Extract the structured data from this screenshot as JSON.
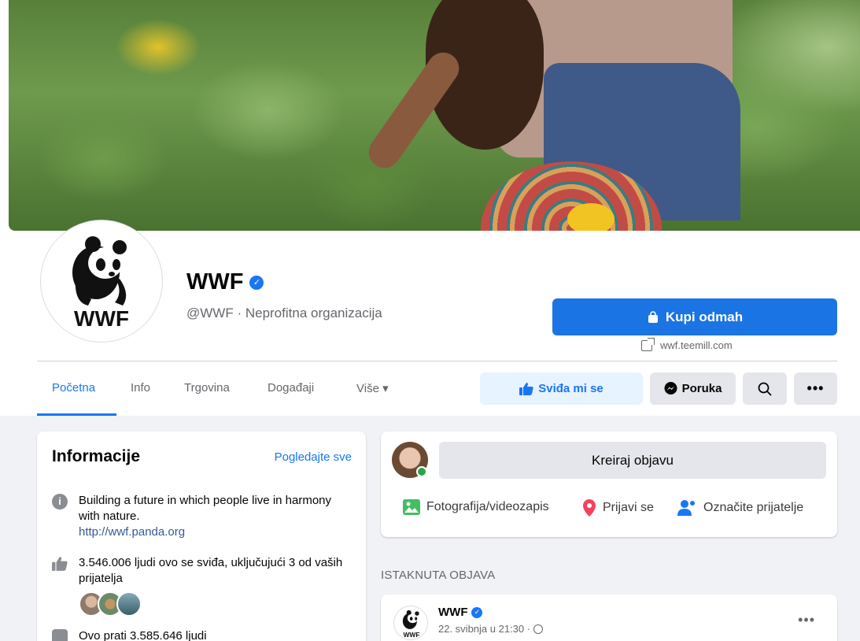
{
  "page": {
    "name": "WWF",
    "handle": "@WWF · Neprofitna organizacija",
    "logo_text": "WWF"
  },
  "shop": {
    "button_label": "Kupi odmah",
    "link_text": "wwf.teemill.com"
  },
  "tabs": [
    {
      "label": "Početna",
      "active": true
    },
    {
      "label": "Info"
    },
    {
      "label": "Trgovina"
    },
    {
      "label": "Događaji"
    },
    {
      "label": "Više ▾"
    }
  ],
  "actions": {
    "like_label": "Sviđa mi se",
    "message_label": "Poruka",
    "more_label": "•••"
  },
  "info": {
    "title": "Informacije",
    "see_all": "Pogledajte sve",
    "description": "Building a future in which people live in harmony with nature.",
    "website": "http://wwf.panda.org",
    "likes_text": "3.546.006 ljudi ovo se sviđa, uključujući 3 od vaših prijatelja",
    "followers_text": "Ovo prati 3.585.646 ljudi"
  },
  "composer": {
    "create_label": "Kreiraj objavu",
    "photo_label": "Fotografija/videozapis",
    "checkin_label": "Prijavi se",
    "tag_label": "Označite prijatelje"
  },
  "featured": {
    "label": "ISTAKNUTA OBJAVA",
    "author": "WWF",
    "time": "22. svibnja u 21:30 ·",
    "more": "•••"
  },
  "colors": {
    "accent": "#1877f2",
    "online": "#31a24c"
  }
}
